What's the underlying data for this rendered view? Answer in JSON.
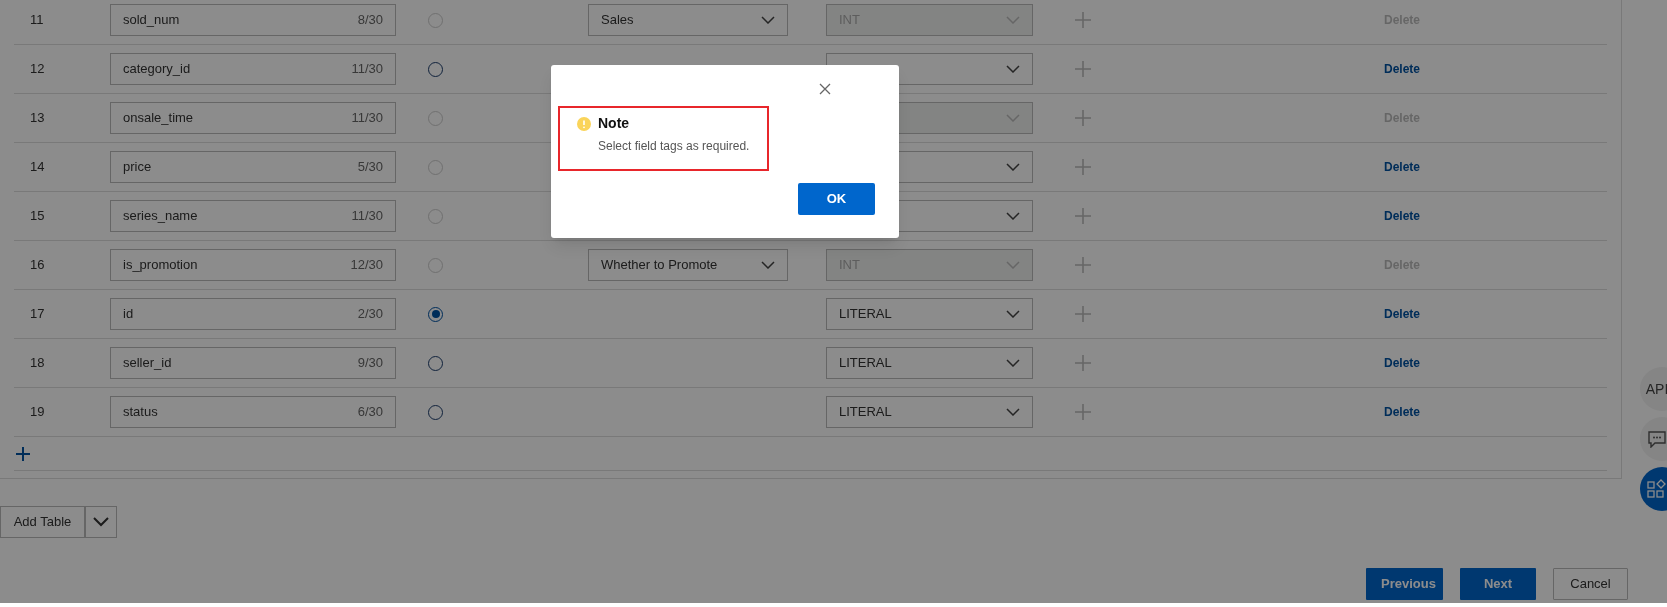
{
  "rows": [
    {
      "index": "11",
      "name": "sold_num",
      "count": "8/30",
      "primary": {
        "selected": false,
        "disabled": true
      },
      "tag": "Sales",
      "type": {
        "value": "INT",
        "disabled": true
      },
      "delete": {
        "label": "Delete",
        "disabled": true
      }
    },
    {
      "index": "12",
      "name": "category_id",
      "count": "11/30",
      "primary": {
        "selected": false,
        "disabled": false
      },
      "type": {
        "disabled": false
      },
      "delete": {
        "label": "Delete",
        "disabled": false
      }
    },
    {
      "index": "13",
      "name": "onsale_time",
      "count": "11/30",
      "primary": {
        "selected": false,
        "disabled": true
      },
      "type": {
        "disabled": true
      },
      "delete": {
        "label": "Delete",
        "disabled": true
      }
    },
    {
      "index": "14",
      "name": "price",
      "count": "5/30",
      "primary": {
        "selected": false,
        "disabled": true
      },
      "type": {
        "disabled": false
      },
      "delete": {
        "label": "Delete",
        "disabled": false
      }
    },
    {
      "index": "15",
      "name": "series_name",
      "count": "11/30",
      "primary": {
        "selected": false,
        "disabled": true
      },
      "type": {
        "disabled": false
      },
      "delete": {
        "label": "Delete",
        "disabled": false
      }
    },
    {
      "index": "16",
      "name": "is_promotion",
      "count": "12/30",
      "primary": {
        "selected": false,
        "disabled": true
      },
      "tag": "Whether to Promote",
      "type": {
        "value": "INT",
        "disabled": true
      },
      "delete": {
        "label": "Delete",
        "disabled": true
      }
    },
    {
      "index": "17",
      "name": "id",
      "count": "2/30",
      "primary": {
        "selected": true,
        "disabled": false
      },
      "type": {
        "value": "LITERAL",
        "disabled": false
      },
      "delete": {
        "label": "Delete",
        "disabled": false
      }
    },
    {
      "index": "18",
      "name": "seller_id",
      "count": "9/30",
      "primary": {
        "selected": false,
        "disabled": false
      },
      "type": {
        "value": "LITERAL",
        "disabled": false
      },
      "delete": {
        "label": "Delete",
        "disabled": false
      }
    },
    {
      "index": "19",
      "name": "status",
      "count": "6/30",
      "primary": {
        "selected": false,
        "disabled": false
      },
      "type": {
        "value": "LITERAL",
        "disabled": false
      },
      "delete": {
        "label": "Delete",
        "disabled": false
      }
    }
  ],
  "add_table": {
    "label": "Add Table"
  },
  "footer_buttons": [
    {
      "label": "Previous",
      "kind": "primary"
    },
    {
      "label": "Next",
      "kind": "primary"
    },
    {
      "label": "Cancel",
      "kind": "secondary"
    }
  ],
  "side_tools": [
    {
      "kind": "api",
      "label": "API"
    },
    {
      "kind": "chat"
    },
    {
      "kind": "apps"
    }
  ],
  "dialog": {
    "title": "Note",
    "message": "Select field tags as required.",
    "ok": "OK"
  }
}
